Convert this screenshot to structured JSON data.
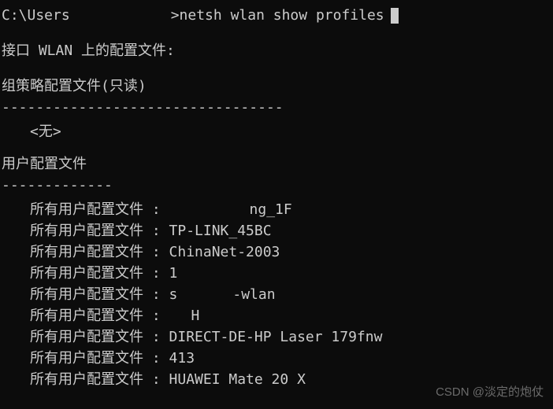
{
  "prompt": {
    "prefix": "C:\\Users",
    "suffix": ">",
    "command": "netsh wlan show profiles"
  },
  "section_header": "接口 WLAN 上的配置文件:",
  "group_policy": {
    "title": "组策略配置文件(只读)",
    "divider": "---------------------------------",
    "none": "<无>"
  },
  "user_profiles": {
    "title": "用户配置文件",
    "divider": "-------------",
    "label": "所有用户配置文件",
    "items": [
      {
        "redacted": true,
        "prefix": "",
        "suffix": "ng_1F",
        "mid_width": 102
      },
      {
        "redacted": false,
        "value": "TP-LINK_45BC"
      },
      {
        "redacted": false,
        "value": "ChinaNet-2003"
      },
      {
        "redacted": false,
        "value": "1"
      },
      {
        "redacted": true,
        "prefix": "s",
        "suffix": "-wlan",
        "mid_width": 70
      },
      {
        "redacted": true,
        "prefix": "",
        "suffix": "H",
        "mid_width": 28
      },
      {
        "redacted": false,
        "value": "DIRECT-DE-HP Laser 179fnw"
      },
      {
        "redacted": false,
        "value": "413"
      },
      {
        "redacted": false,
        "value": "HUAWEI Mate 20 X"
      }
    ]
  },
  "watermark": "CSDN @淡定的炮仗"
}
